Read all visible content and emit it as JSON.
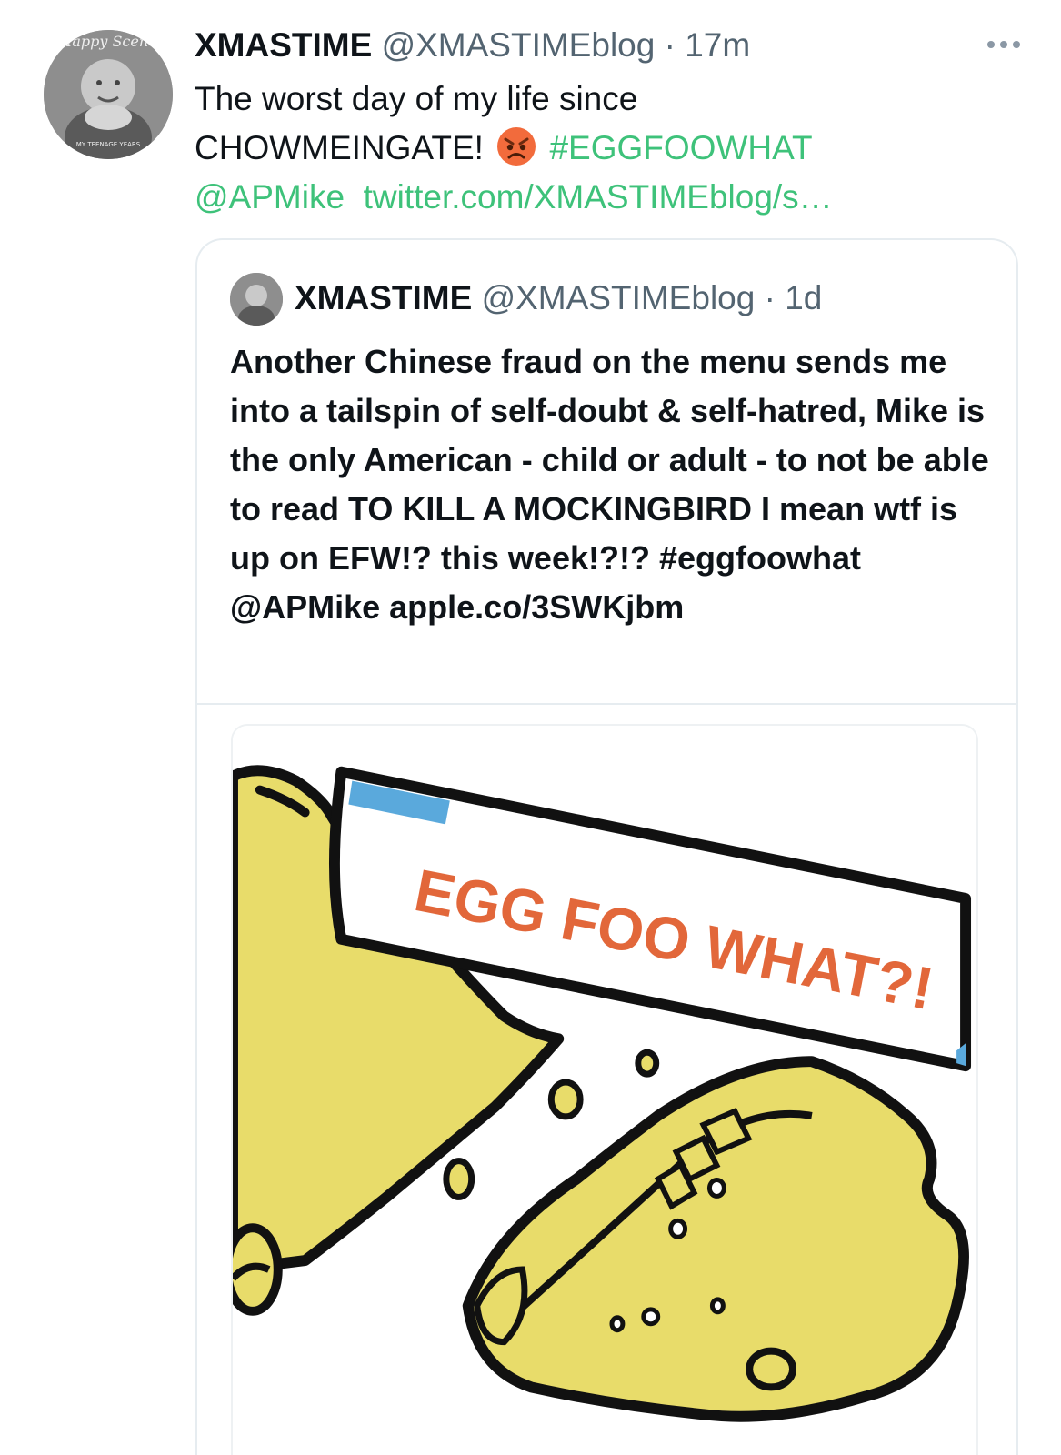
{
  "tweet": {
    "author_name": "XMASTIME",
    "author_handle": "@XMASTIMEblog",
    "separator": "·",
    "time": "17m",
    "text_line1": "The worst day of my life since",
    "text_line2": "CHOWMEINGATE!",
    "emoji": "angry-face-emoji",
    "hashtag": "#EGGFOOWHAT",
    "mention": "@APMike",
    "link": "twitter.com/XMASTIMEblog/s…",
    "avatar_text_top": "Happy Scene",
    "avatar_text_bottom": "MY TEENAGE YEARS"
  },
  "quoted": {
    "author_name": "XMASTIME",
    "author_handle": "@XMASTIMEblog",
    "separator": "·",
    "time": "1d",
    "text": "Another Chinese fraud on the menu sends me into a tailspin of self-doubt & self-hatred, Mike is the only American - child or adult - to not be able to read TO KILL A MOCKINGBIRD I mean wtf is up on EFW!? this week!?!? #eggfoowhat @APMike apple.co/3SWKjbm",
    "media_label": "EGG FOO WHAT?!"
  },
  "colors": {
    "link": "#3ec27a",
    "secondary_text": "#536471",
    "cookie_yellow": "#e8dc6a",
    "banner_text": "#e2673a",
    "banner_blue": "#5aa9dc"
  }
}
